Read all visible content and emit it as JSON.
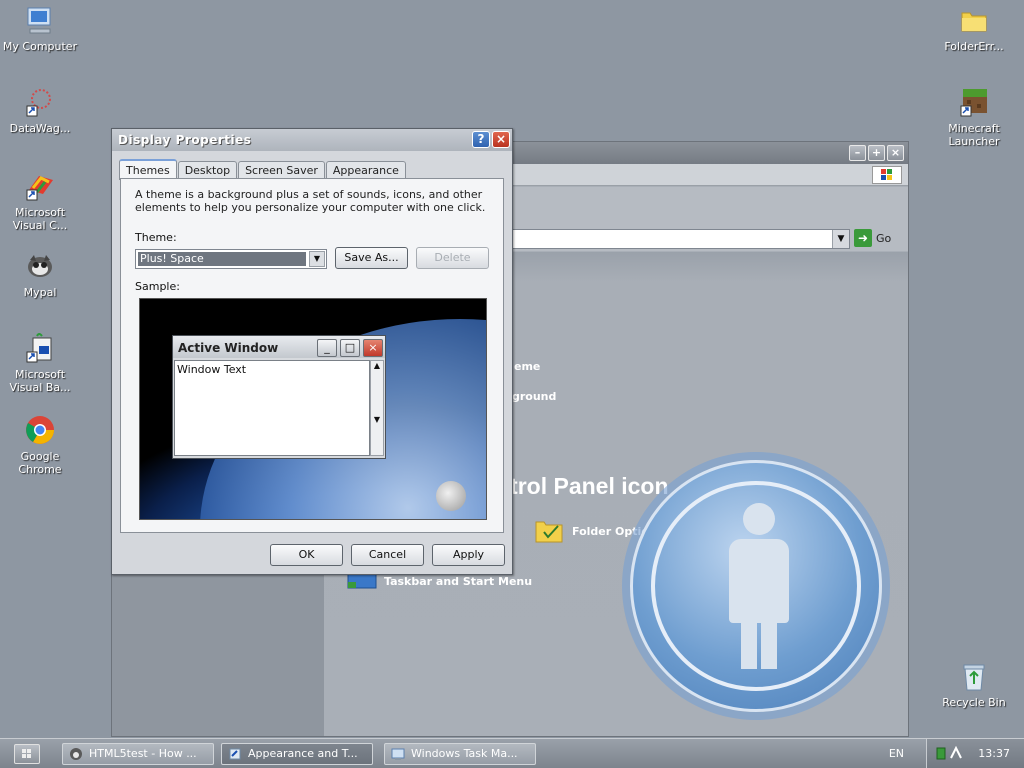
{
  "desktop": {
    "icons": [
      {
        "label": "My Computer",
        "icon": "computer-icon"
      },
      {
        "label": "DataWag...",
        "icon": "datawag-icon"
      },
      {
        "label": "Microsoft Visual C...",
        "icon": "visual-c-icon"
      },
      {
        "label": "Mypal",
        "icon": "mypal-icon"
      },
      {
        "label": "Microsoft Visual Ba...",
        "icon": "visual-basic-icon"
      },
      {
        "label": "Google Chrome",
        "icon": "chrome-icon"
      },
      {
        "label": "FolderErr...",
        "icon": "folder-icon"
      },
      {
        "label": "Minecraft Launcher",
        "icon": "minecraft-icon"
      },
      {
        "label": "Recycle Bin",
        "icon": "recycle-bin-icon"
      }
    ]
  },
  "explorer": {
    "go_label": "Go",
    "section_title": "ntrol Panel icon",
    "links": {
      "theme_partial": "eme",
      "background_partial": "ground",
      "folder_options": "Folder Options",
      "taskbar": "Taskbar and Start Menu"
    }
  },
  "dialog": {
    "title": "Display Properties",
    "tabs": [
      "Themes",
      "Desktop",
      "Screen Saver",
      "Appearance"
    ],
    "description": "A theme is a background plus a set of sounds, icons, and other elements to help you personalize your computer with one click.",
    "theme_label": "Theme:",
    "theme_value": "Plus! Space",
    "save_as": "Save As...",
    "delete": "Delete",
    "sample_label": "Sample:",
    "sample_window": {
      "title": "Active Window",
      "body": "Window Text"
    },
    "ok": "OK",
    "cancel": "Cancel",
    "apply": "Apply"
  },
  "taskbar": {
    "tasks": [
      {
        "label": "HTML5test - How ...",
        "active": false
      },
      {
        "label": "Appearance and T...",
        "active": true
      },
      {
        "label": "Windows Task Ma...",
        "active": false
      }
    ],
    "language": "EN",
    "clock": "13:37"
  },
  "colors": {
    "desktop_bg": "#8e97a2",
    "dialog_bg": "#d4d7dc",
    "close_red": "#c0392b",
    "help_blue": "#2f62b0"
  }
}
